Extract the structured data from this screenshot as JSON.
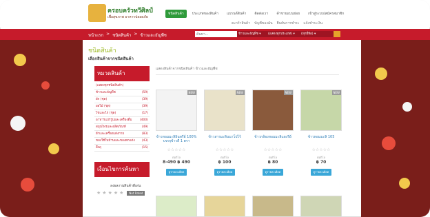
{
  "header": {
    "logo_title": "ครอบครัวทวีศิลป์",
    "logo_sub": "เพื่อสุขภาพ อาหารปลอดภัย",
    "nav_primary": [
      "ชนิดสินค้า",
      "ประเภทของสินค้า",
      "แบรนด์สินค้า",
      "ติดต่อเรา",
      "ค้าขายแบบย่อย",
      "เข้าสู่ระบบ/สมัครสมาชิก"
    ],
    "nav_secondary": [
      "ตะกร้าสินค้า",
      "บัญชีของฉัน",
      "ยืนยันการชำระ",
      "แจ้งชำระเงิน"
    ]
  },
  "toolbar": {
    "breadcrumb": [
      "หน้าแรก",
      ">",
      "ชนิดสินค้า",
      ">",
      "ข้าวและธัญพืช"
    ],
    "search_placeholder": "ค้นหา...",
    "dd1": "ข้าวและธัญพืช ▾",
    "dd2": "(แสดงทุกประเภท) ▾",
    "dd3": "(ทุกยี่ห้อ) ▾"
  },
  "page": {
    "title": "ชนิดสินค้า",
    "subtitle": "เลือกสินค้าจากชนิดสินค้า",
    "crumb": "แสดงสินค้าจากชนิดสินค้า ข้าวและธัญพืช"
  },
  "sidebar": {
    "category_head": "หมวดสินค้า",
    "categories": [
      {
        "label": "(แสดงทุกชนิดสินค้า)",
        "count": ""
      },
      {
        "label": "ข้าวและธัญพืช",
        "count": "(59)"
      },
      {
        "label": "ผัก (ชุด)",
        "count": "(39)"
      },
      {
        "label": "ผลไม้ (ชุด)",
        "count": "(39)"
      },
      {
        "label": "ไข่และไก่ (ชุด)",
        "count": "(17)"
      },
      {
        "label": "อาหารแปรรูปและเครื่องดื่ม",
        "count": "(400)"
      },
      {
        "label": "สมุนไพรและผลิตภัณฑ์",
        "count": "(49)"
      },
      {
        "label": "ผ้าและเครื่องแต่งกาย",
        "count": "(83)"
      },
      {
        "label": "ของใช้ในบ้านและของตกแต่ง",
        "count": "(43)"
      },
      {
        "label": "อื่นๆ",
        "count": "(15)"
      }
    ],
    "service_head": "เงื่อนไขการค้นหา",
    "rating_title": "ลงผลงานสินค้าดีเด่น",
    "rating_tag": "Not Rated"
  },
  "products": [
    {
      "name": "ข้าวหอมมะลิอินทรีย์ 100% บรรจุข้าวดี 1 ตรา",
      "unit": "ต่อกิโล",
      "price": "8-490 ฿ 490",
      "button": "ดูรายละเอียด",
      "badge": "NEW"
    },
    {
      "name": "ข้าวสารมะลินนาโปไร้",
      "unit": "ต่อกิโล",
      "price": "฿ 100",
      "button": "ดูรายละเอียด",
      "badge": "NEW"
    },
    {
      "name": "ข้าวกล้องหอมมะลิแดงรีย์",
      "unit": "ต่อกิโล",
      "price": "฿ 80",
      "button": "ดูรายละเอียด",
      "badge": "NEW"
    },
    {
      "name": "ข้าวหอมมะลิ 105",
      "unit": "ต่อกิโล",
      "price": "฿ 70",
      "button": "ดูรายละเอียด",
      "badge": "NEW"
    }
  ]
}
